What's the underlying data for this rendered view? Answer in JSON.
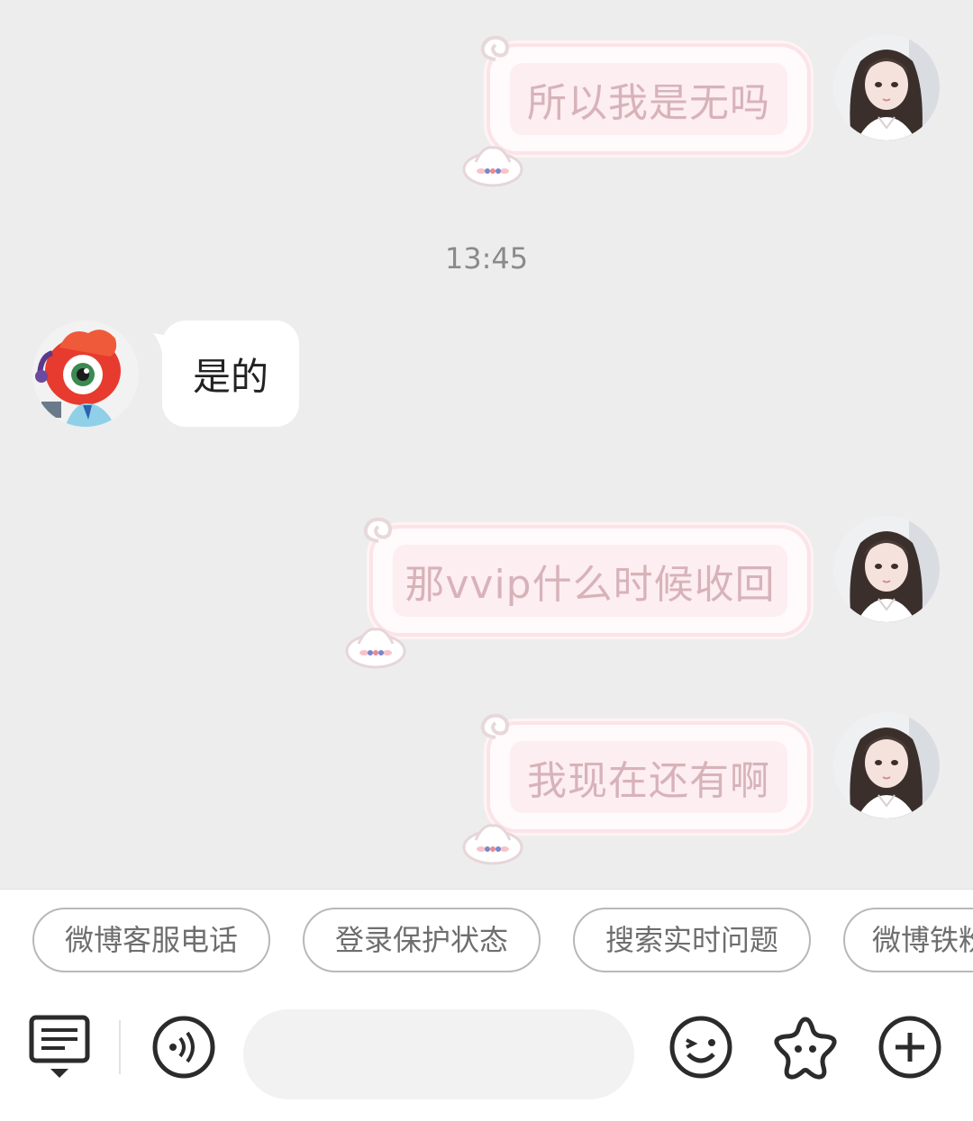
{
  "messages": [
    {
      "text": "所以我是无吗"
    },
    {
      "text": "那vvip什么时候收回"
    },
    {
      "text": "我现在还有啊"
    }
  ],
  "timestamp": "13:45",
  "incoming": {
    "text": "是的"
  },
  "quick_replies": [
    "微博客服电话",
    "登录保护状态",
    "搜索实时问题",
    "微博铁粉"
  ],
  "input": {
    "placeholder": ""
  },
  "icons": {
    "menu": "menu-list-icon",
    "voice": "voice-icon",
    "emoji": "emoji-icon",
    "sticker": "star-sticker-icon",
    "more": "plus-icon"
  },
  "colors": {
    "background": "#ededed",
    "bubble_border": "#fbe4e8",
    "bubble_text": "#d7b3b9",
    "incoming_bubble": "#ffffff"
  }
}
